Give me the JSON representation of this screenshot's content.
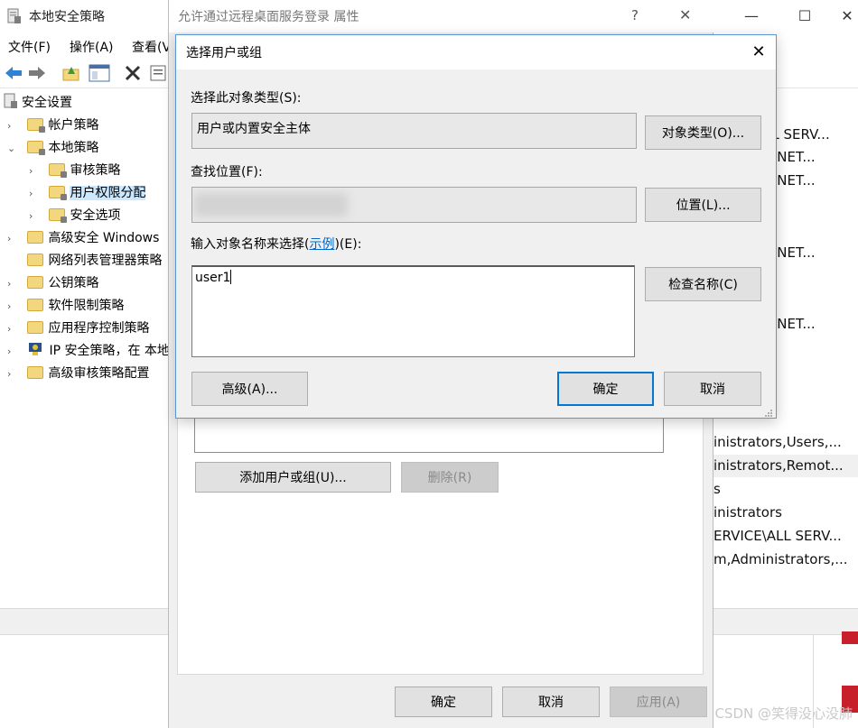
{
  "lsp": {
    "title": "本地安全策略",
    "menu": [
      "文件(F)",
      "操作(A)",
      "查看(V"
    ],
    "tree": [
      {
        "label": "安全设置",
        "level": 0,
        "chevron": "",
        "icon": "security-settings-icon"
      },
      {
        "label": "帐户策略",
        "level": 1,
        "chevron": "›",
        "icon": "folder-lock-icon"
      },
      {
        "label": "本地策略",
        "level": 1,
        "chevron": "⌄",
        "icon": "folder-lock-icon"
      },
      {
        "label": "审核策略",
        "level": 2,
        "chevron": "›",
        "icon": "folder-lock-icon"
      },
      {
        "label": "用户权限分配",
        "level": 2,
        "chevron": "›",
        "icon": "folder-lock-icon",
        "selected": true
      },
      {
        "label": "安全选项",
        "level": 2,
        "chevron": "›",
        "icon": "folder-lock-icon"
      },
      {
        "label": "高级安全 Windows",
        "level": 1,
        "chevron": "›",
        "icon": "folder-icon"
      },
      {
        "label": "网络列表管理器策略",
        "level": 1,
        "chevron": "",
        "icon": "folder-icon"
      },
      {
        "label": "公钥策略",
        "level": 1,
        "chevron": "›",
        "icon": "folder-icon"
      },
      {
        "label": "软件限制策略",
        "level": 1,
        "chevron": "›",
        "icon": "folder-icon"
      },
      {
        "label": "应用程序控制策略",
        "level": 1,
        "chevron": "›",
        "icon": "folder-icon"
      },
      {
        "label": "IP 安全策略，在 本地",
        "level": 1,
        "chevron": "›",
        "icon": "ip-security-icon"
      },
      {
        "label": "高级审核策略配置",
        "level": 1,
        "chevron": "›",
        "icon": "folder-icon"
      }
    ],
    "list_column": [
      "LL SERV...",
      "E,NET...",
      "E,NET...",
      "E,NET...",
      "E,NET...",
      "inistrators,Users,...",
      "inistrators,Remot...",
      "s",
      "inistrators",
      "ERVICE\\ALL SERV...",
      "m,Administrators,..."
    ]
  },
  "props": {
    "title": "允许通过远程桌面服务登录 属性",
    "help": "?",
    "close": "✕",
    "add_button": "添加用户或组(U)...",
    "remove_button": "删除(R)",
    "ok_button": "确定",
    "cancel_button": "取消",
    "apply_button": "应用(A)"
  },
  "select_dialog": {
    "title": "选择用户或组",
    "close": "✕",
    "object_type_label": "选择此对象类型(S):",
    "object_type_value": "用户或内置安全主体",
    "object_types_button": "对象类型(O)...",
    "location_label": "查找位置(F):",
    "locations_button": "位置(L)...",
    "enter_names_label_prefix": "输入对象名称来选择(",
    "examples_link": "示例",
    "enter_names_label_suffix": ")(E):",
    "names_value": "user1",
    "check_names_button": "检查名称(C)",
    "advanced_button": "高级(A)...",
    "ok_button": "确定",
    "cancel_button": "取消"
  },
  "window_controls": {
    "minimize": "—",
    "maximize": "☐",
    "close": "✕"
  },
  "watermark": "CSDN @笑得没心没肺",
  "colors": {
    "accent": "#0078d7",
    "dialog_bg": "#f0f0f0",
    "selection": "#cce8ff",
    "link": "#0066cc"
  }
}
